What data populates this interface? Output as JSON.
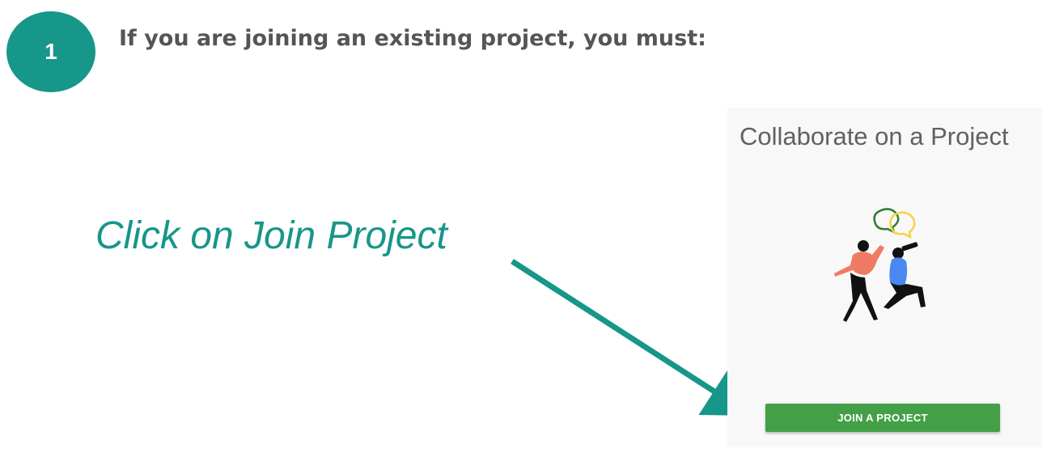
{
  "step": {
    "number": "1",
    "heading": "If you are joining an existing project, you must:"
  },
  "instruction": {
    "text": "Click on Join Project"
  },
  "card": {
    "title": "Collaborate on a Project",
    "button_label": "JOIN A PROJECT"
  },
  "colors": {
    "accent": "#17968a",
    "button": "#43a047",
    "card_background": "#f8f8f8",
    "heading_text": "#555555"
  },
  "icons": {
    "arrow": "arrow-pointing-to-button",
    "illustration": "collaboration-people-speech-bubbles"
  }
}
